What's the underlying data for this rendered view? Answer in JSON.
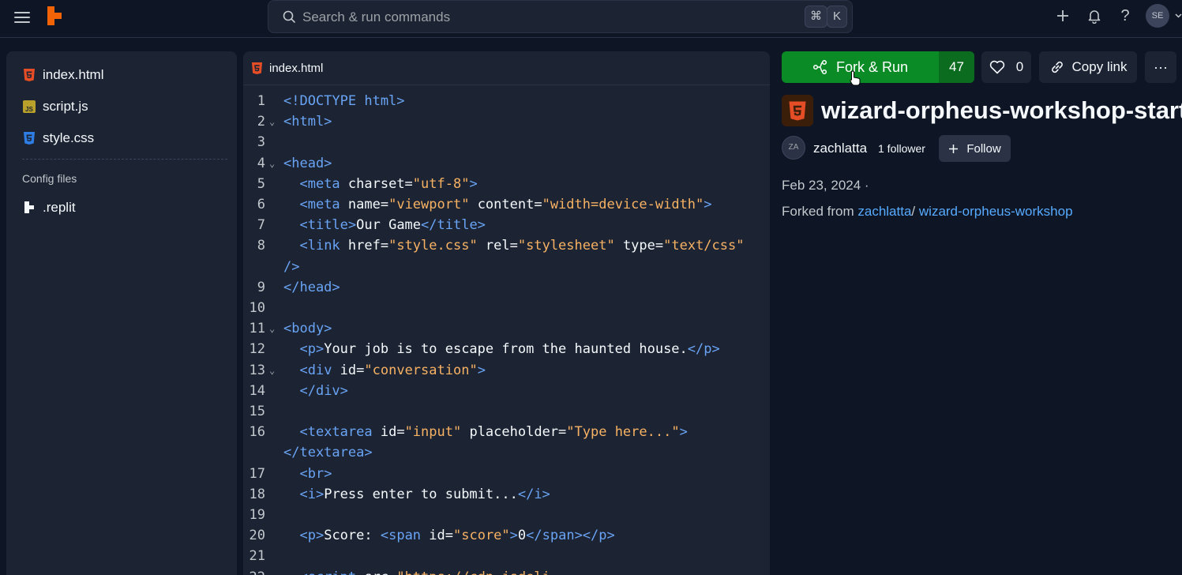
{
  "topbar": {
    "search_placeholder": "Search & run commands",
    "shortcut_keys": [
      "⌘",
      "K"
    ],
    "avatar_initials": "SE",
    "icons": [
      "menu-icon",
      "replit-logo",
      "search-icon",
      "plus-icon",
      "bell-icon",
      "help-icon",
      "avatar",
      "chevron-down-icon"
    ]
  },
  "sidebar": {
    "files": [
      {
        "name": "index.html",
        "icon": "html5-icon"
      },
      {
        "name": "script.js",
        "icon": "js-icon"
      },
      {
        "name": "style.css",
        "icon": "css3-icon"
      }
    ],
    "config_label": "Config files",
    "config_files": [
      {
        "name": ".replit",
        "icon": "replit-config-icon"
      }
    ]
  },
  "editor": {
    "tab_name": "index.html",
    "lines": [
      {
        "n": "1",
        "fold": false
      },
      {
        "n": "2",
        "fold": true
      },
      {
        "n": "3",
        "fold": false
      },
      {
        "n": "4",
        "fold": true
      },
      {
        "n": "5",
        "fold": false
      },
      {
        "n": "6",
        "fold": false
      },
      {
        "n": "7",
        "fold": false
      },
      {
        "n": "8",
        "fold": false
      },
      {
        "n": "",
        "fold": false
      },
      {
        "n": "9",
        "fold": false
      },
      {
        "n": "10",
        "fold": false
      },
      {
        "n": "11",
        "fold": true
      },
      {
        "n": "12",
        "fold": false
      },
      {
        "n": "13",
        "fold": true
      },
      {
        "n": "14",
        "fold": false
      },
      {
        "n": "15",
        "fold": false
      },
      {
        "n": "16",
        "fold": false
      },
      {
        "n": "",
        "fold": false
      },
      {
        "n": "17",
        "fold": false
      },
      {
        "n": "18",
        "fold": false
      },
      {
        "n": "19",
        "fold": false
      },
      {
        "n": "20",
        "fold": false
      },
      {
        "n": "21",
        "fold": false
      },
      {
        "n": "22",
        "fold": false
      }
    ],
    "code": [
      [
        [
          "dt",
          "<!DOCTYPE html>"
        ]
      ],
      [
        [
          "tg",
          "<html>"
        ]
      ],
      [],
      [
        [
          "tg",
          "<head>"
        ]
      ],
      [
        [
          "at",
          "  "
        ],
        [
          "tg",
          "<meta "
        ],
        [
          "at",
          "charset="
        ],
        [
          "st",
          "\"utf-8\""
        ],
        [
          "tg",
          ">"
        ]
      ],
      [
        [
          "at",
          "  "
        ],
        [
          "tg",
          "<meta "
        ],
        [
          "at",
          "name="
        ],
        [
          "st",
          "\"viewport\""
        ],
        [
          "at",
          " content="
        ],
        [
          "st",
          "\"width=device-width\""
        ],
        [
          "tg",
          ">"
        ]
      ],
      [
        [
          "at",
          "  "
        ],
        [
          "tg",
          "<title>"
        ],
        [
          "at",
          "Our Game"
        ],
        [
          "tg",
          "</title>"
        ]
      ],
      [
        [
          "at",
          "  "
        ],
        [
          "tg",
          "<link "
        ],
        [
          "at",
          "href="
        ],
        [
          "st",
          "\"style.css\""
        ],
        [
          "at",
          " rel="
        ],
        [
          "st",
          "\"stylesheet\""
        ],
        [
          "at",
          " type="
        ],
        [
          "st",
          "\"text/css\""
        ]
      ],
      [
        [
          "tg",
          "/>"
        ]
      ],
      [
        [
          "tg",
          "</head>"
        ]
      ],
      [],
      [
        [
          "tg",
          "<body>"
        ]
      ],
      [
        [
          "at",
          "  "
        ],
        [
          "tg",
          "<p>"
        ],
        [
          "at",
          "Your job is to escape from the haunted house."
        ],
        [
          "tg",
          "</p>"
        ]
      ],
      [
        [
          "at",
          "  "
        ],
        [
          "tg",
          "<div "
        ],
        [
          "at",
          "id="
        ],
        [
          "st",
          "\"conversation\""
        ],
        [
          "tg",
          ">"
        ]
      ],
      [
        [
          "at",
          "  "
        ],
        [
          "tg",
          "</div>"
        ]
      ],
      [],
      [
        [
          "at",
          "  "
        ],
        [
          "tg",
          "<textarea "
        ],
        [
          "at",
          "id="
        ],
        [
          "st",
          "\"input\""
        ],
        [
          "at",
          " placeholder="
        ],
        [
          "st",
          "\"Type here...\""
        ],
        [
          "tg",
          ">"
        ]
      ],
      [
        [
          "tg",
          "</textarea>"
        ]
      ],
      [
        [
          "at",
          "  "
        ],
        [
          "tg",
          "<br>"
        ]
      ],
      [
        [
          "at",
          "  "
        ],
        [
          "tg",
          "<i>"
        ],
        [
          "at",
          "Press enter to submit..."
        ],
        [
          "tg",
          "</i>"
        ]
      ],
      [],
      [
        [
          "at",
          "  "
        ],
        [
          "tg",
          "<p>"
        ],
        [
          "at",
          "Score: "
        ],
        [
          "tg",
          "<span "
        ],
        [
          "at",
          "id="
        ],
        [
          "st",
          "\"score\""
        ],
        [
          "tg",
          ">"
        ],
        [
          "at",
          "0"
        ],
        [
          "tg",
          "</span></p>"
        ]
      ],
      [],
      [
        [
          "at",
          "  "
        ],
        [
          "tg",
          "<script "
        ],
        [
          "at",
          "src="
        ],
        [
          "st",
          "\"https://cdn.jsdeli"
        ]
      ]
    ]
  },
  "repl": {
    "fork_label": "Fork & Run",
    "fork_count": "47",
    "like_count": "0",
    "copy_label": "Copy link",
    "more_label": "···",
    "title": "wizard-orpheus-workshop-starter",
    "owner_initials": "ZA",
    "owner": "zachlatta",
    "followers": "1 follower",
    "follow_label": "Follow",
    "date": "Feb 23, 2024 ·",
    "forked_prefix": "Forked from",
    "forked_owner": "zachlatta",
    "forked_sep": "/",
    "forked_repl": "wizard-orpheus-workshop"
  },
  "colors": {
    "background": "#0e1525",
    "panel": "#1c2333",
    "accent_green": "#0a8b26",
    "tag_blue": "#69a4f5",
    "string_orange": "#f7b263",
    "link_blue": "#57abff",
    "replit_orange": "#f26207"
  }
}
